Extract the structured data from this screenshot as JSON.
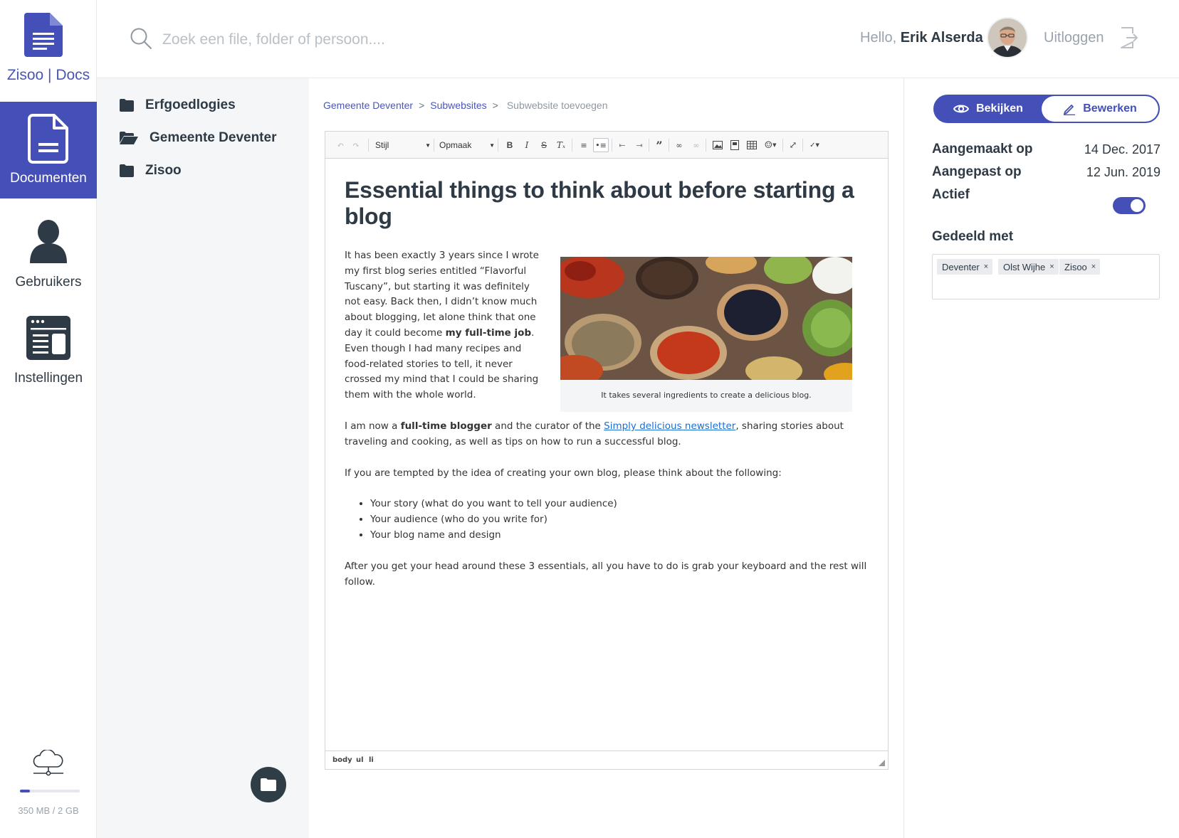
{
  "app": {
    "logo_brand": "Zisoo",
    "logo_sep": " | ",
    "logo_product": "Docs"
  },
  "nav": {
    "documents": "Documenten",
    "users": "Gebruikers",
    "settings": "Instellingen"
  },
  "storage": {
    "text": "350 MB / 2 GB",
    "fraction_used": 0.17
  },
  "header": {
    "search_placeholder": "Zoek een file, folder of persoon....",
    "greeting": "Hello, ",
    "user_name": "Erik Alserda",
    "logout": "Uitloggen"
  },
  "folders": [
    {
      "name": "Erfgoedlogies",
      "icon": "folder-closed-icon"
    },
    {
      "name": "Gemeente Deventer",
      "icon": "folder-open-icon"
    },
    {
      "name": "Zisoo",
      "icon": "folder-closed-icon"
    }
  ],
  "breadcrumb": {
    "items": [
      "Gemeente Deventer",
      "Subwebsites",
      "Subwebsite toevoegen"
    ],
    "separator": ">"
  },
  "toolbar": {
    "style_select": "Stijl",
    "format_select": "Opmaak"
  },
  "document": {
    "title": "Essential things to think about before starting a blog",
    "p1_a": "It has been exactly 3 years since I wrote my first blog series entitled “Flavorful Tuscany”, but starting it was definitely not easy. Back then, I didn’t know much about blogging, let alone think that one day it could become ",
    "p1_bold": "my full-time job",
    "p1_b": ". Even though I had many recipes and food-related stories to tell, it never crossed my mind that I could be sharing them with the whole world.",
    "p2_a": "I am now a ",
    "p2_bold": "full-time blogger",
    "p2_b": " and the curator of the ",
    "p2_link": "Simply delicious newsletter",
    "p2_c": ", sharing stories about traveling and cooking, as well as tips on how to run a successful blog.",
    "p3": "If you are tempted by the idea of creating your own blog, please think about the following:",
    "list": [
      "Your story (what do you want to tell your audience)",
      "Your audience (who do you write for)",
      "Your blog name and design"
    ],
    "p4": "After you get your head around these 3 essentials, all you have to do is grab your keyboard and the rest will follow.",
    "figure_caption": "It takes several ingredients to create a delicious blog."
  },
  "statusbar": {
    "path": [
      "body",
      "ul",
      "li"
    ]
  },
  "side": {
    "view_label": "Bekijken",
    "edit_label": "Bewerken",
    "created_label": "Aangemaakt op",
    "created_value": "14 Dec. 2017",
    "modified_label": "Aangepast op",
    "modified_value": "12 Jun. 2019",
    "active_label": "Actief",
    "active": true,
    "shared_label": "Gedeeld met",
    "shared_tags": [
      "Deventer",
      "Olst Wijhe",
      "Zisoo"
    ],
    "tag_remove": "×"
  },
  "colors": {
    "accent": "#4450b8",
    "text": "#2e3a45",
    "muted": "#9aa3ad",
    "panel": "#f4f6f8"
  }
}
